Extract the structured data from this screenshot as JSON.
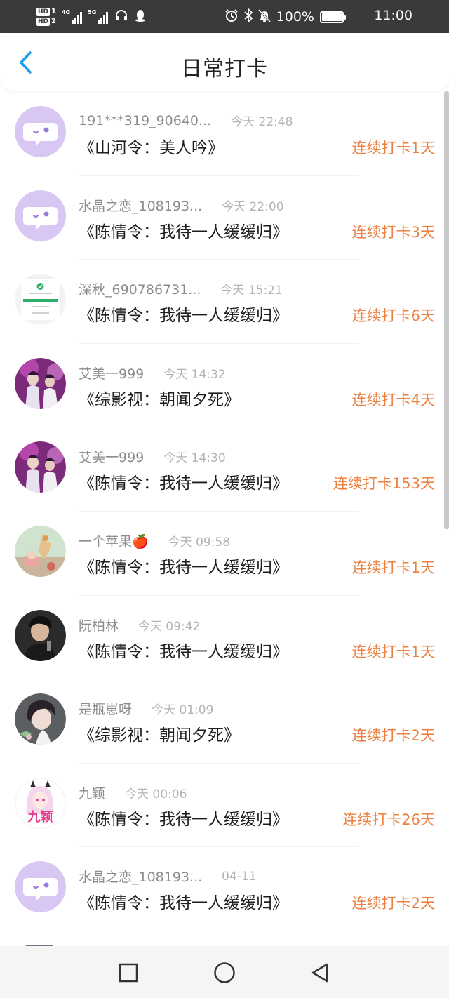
{
  "status_bar": {
    "hd1": "HD",
    "hd1_num": "1",
    "hd2": "HD",
    "hd2_num": "2",
    "net1": "4G",
    "net2": "5G",
    "battery": "100%",
    "time": "11:00"
  },
  "header": {
    "title": "日常打卡"
  },
  "checkins": [
    {
      "username": "191***319_90640...",
      "time": "今天 22:48",
      "book": "《山河令：美人吟》",
      "streak": "连续打卡1天",
      "avatar": "default-chat-avatar"
    },
    {
      "username": "水晶之恋_108193...",
      "time": "今天 22:00",
      "book": "《陈情令：我待一人缓缓归》",
      "streak": "连续打卡3天",
      "avatar": "default-chat-avatar"
    },
    {
      "username": "深秋_690786731...",
      "time": "今天 15:21",
      "book": "《陈情令：我待一人缓缓归》",
      "streak": "连续打卡6天",
      "avatar": "screenshot-avatar"
    },
    {
      "username": "艾美一999",
      "time": "今天 14:32",
      "book": "《综影视：朝闻夕死》",
      "streak": "连续打卡4天",
      "avatar": "purple-photo-avatar"
    },
    {
      "username": "艾美一999",
      "time": "今天 14:30",
      "book": "《陈情令：我待一人缓缓归》",
      "streak": "连续打卡153天",
      "avatar": "purple-photo-avatar"
    },
    {
      "username": "一个苹果🍎",
      "time": "今天 09:58",
      "book": "《陈情令：我待一人缓缓归》",
      "streak": "连续打卡1天",
      "avatar": "illustration-avatar"
    },
    {
      "username": "阮柏林",
      "time": "今天 09:42",
      "book": "《陈情令：我待一人缓缓归》",
      "streak": "连续打卡1天",
      "avatar": "dark-photo-avatar"
    },
    {
      "username": "是瓶崽呀",
      "time": "今天 01:09",
      "book": "《综影视：朝闻夕死》",
      "streak": "连续打卡2天",
      "avatar": "anime-avatar"
    },
    {
      "username": "九颖",
      "time": "今天 00:06",
      "book": "《陈情令：我待一人缓缓归》",
      "streak": "连续打卡26天",
      "avatar": "pink-anime-avatar",
      "avatar_text": "九颖"
    },
    {
      "username": "水晶之恋_108193...",
      "time": "04-11",
      "book": "《陈情令：我待一人缓缓归》",
      "streak": "连续打卡2天",
      "avatar": "default-chat-avatar"
    }
  ],
  "colors": {
    "accent": "#1a9cf0",
    "streak": "#ee8040",
    "status_bar_bg": "#3a3a3a",
    "default_avatar_bg": "#d7c7f2",
    "default_avatar_icon": "#9b77e0"
  },
  "nav": {
    "icons": [
      "square-icon",
      "circle-icon",
      "triangle-back-icon"
    ]
  }
}
